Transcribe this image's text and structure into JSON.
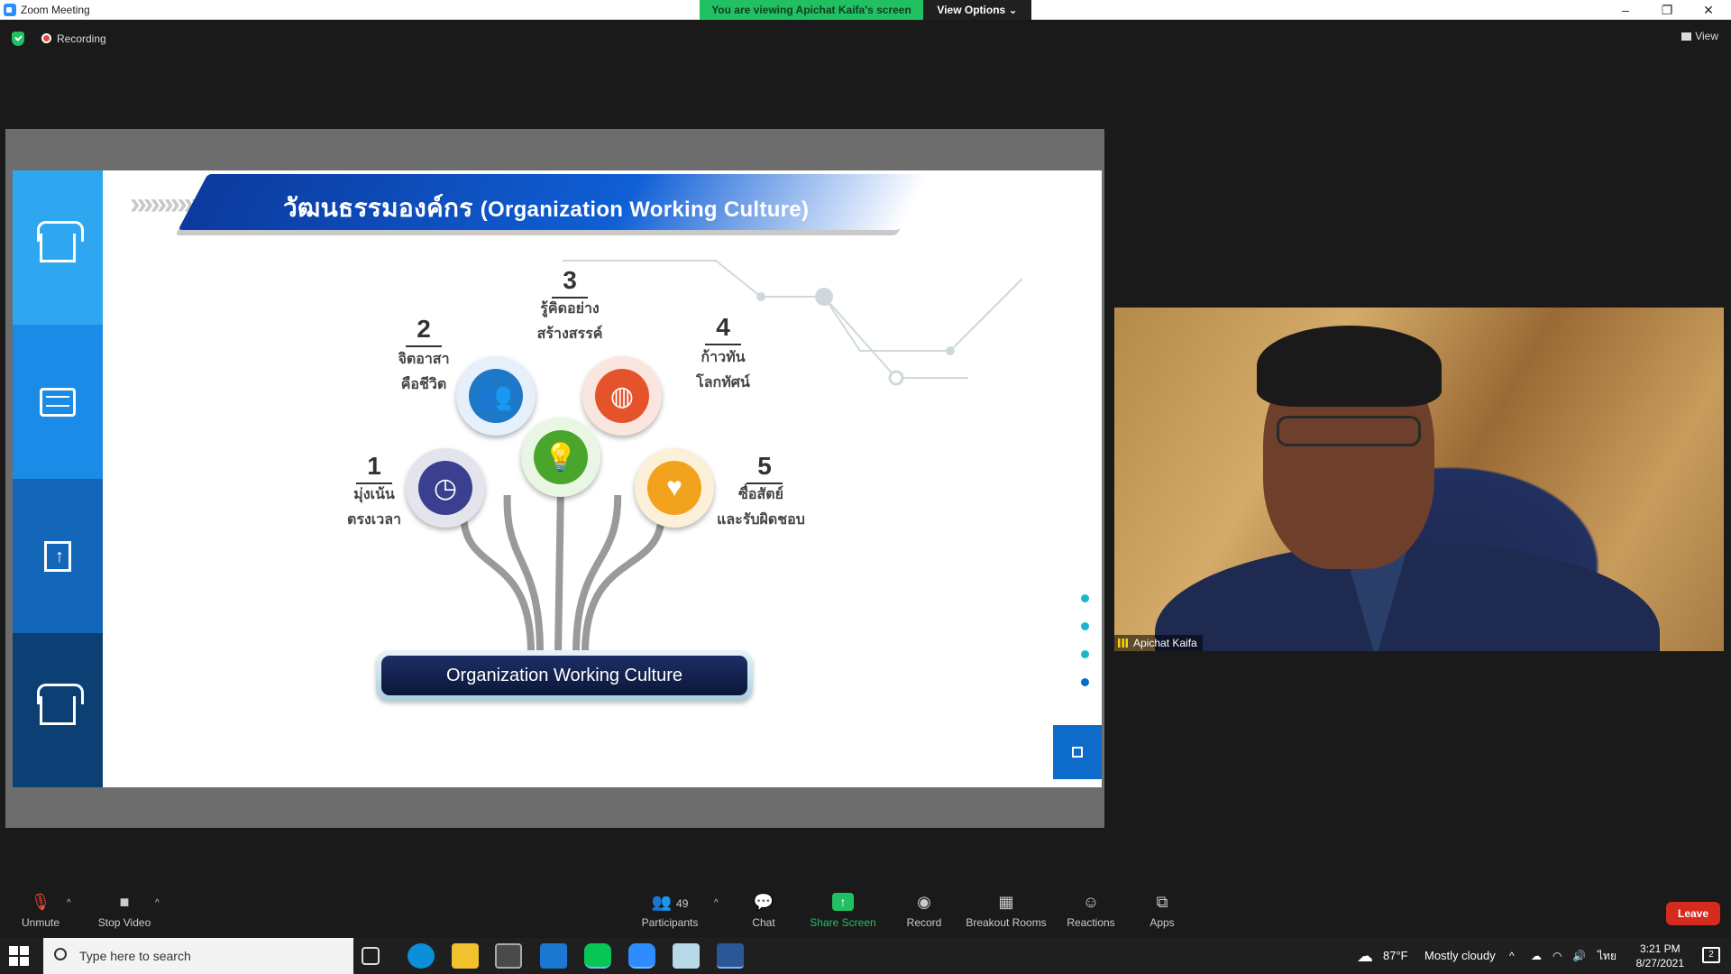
{
  "window": {
    "title": "Zoom Meeting",
    "viewing_banner": "You are viewing Apichat Kaifa's screen",
    "view_options": "View Options ⌄",
    "minimize": "–",
    "restore": "❐",
    "close": "✕"
  },
  "meeting": {
    "recording_label": "Recording",
    "view_label": "View"
  },
  "slide": {
    "title_th": "วัฒนธรรมองค์กร",
    "title_en": "(Organization Working Culture)",
    "items": [
      {
        "number": "1",
        "line1": "มุ่งเน้น",
        "line2": "ตรงเวลา"
      },
      {
        "number": "2",
        "line1": "จิตอาสา",
        "line2": "คือชีวิต"
      },
      {
        "number": "3",
        "line1": "รู้คิดอย่าง",
        "line2": "สร้างสรรค์"
      },
      {
        "number": "4",
        "line1": "ก้าวทัน",
        "line2": "โลกทัศน์"
      },
      {
        "number": "5",
        "line1": "ซื่อสัตย์",
        "line2": "และรับผิดชอบ"
      }
    ],
    "banner": "Organization Working Culture"
  },
  "video": {
    "participant_name": "Apichat Kaifa"
  },
  "toolbar": {
    "unmute": "Unmute",
    "stop_video": "Stop Video",
    "participants": "Participants",
    "participants_count": "49",
    "chat": "Chat",
    "share_screen": "Share Screen",
    "record": "Record",
    "breakout_rooms": "Breakout Rooms",
    "reactions": "Reactions",
    "apps": "Apps",
    "leave": "Leave"
  },
  "taskbar": {
    "search_placeholder": "Type here to search",
    "weather_temp": "87°F",
    "weather_desc": "Mostly cloudy",
    "language": "ไทย",
    "time": "3:21 PM",
    "date": "8/27/2021",
    "notification_count": "2"
  },
  "colors": {
    "zoom_blue": "#2d8cff",
    "zoom_green": "#21c063",
    "leave_red": "#d52b1e",
    "slide_header_blue": "#0f5fd6"
  }
}
